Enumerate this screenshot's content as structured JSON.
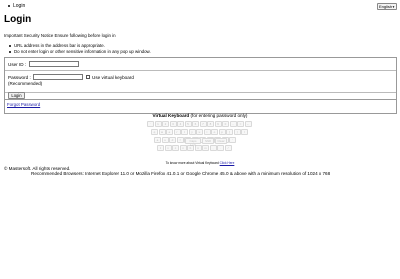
{
  "nav": {
    "login_link": "Login"
  },
  "language": {
    "selected": "English"
  },
  "page": {
    "title": "Login"
  },
  "notice": {
    "heading": "Important Security Notice Ensure following before login in",
    "items": [
      "URL address in the address bar is appropriate.",
      "Do not enter login or other sensitive information in any pop up window."
    ]
  },
  "form": {
    "userid_label": "User ID :",
    "userid_value": "",
    "password_label": "Password :",
    "password_value": "",
    "recommended": "(Recommended)",
    "virtual_keyboard_label": "Use virtual keyboard",
    "login_button": "Login",
    "forgot_link": "Forgot Password"
  },
  "virtual_keyboard": {
    "title_bold": "Virtual Keyboard",
    "title_rest": " (for entering password only)",
    "hint": "To know more about Virtual Keyboard",
    "hint_link": "Click Here",
    "keys": {
      "row1": [
        "`",
        "1",
        "2",
        "3",
        "4",
        "5",
        "6",
        "7",
        "8",
        "9",
        "0",
        "-",
        "=",
        "←"
      ],
      "row2": [
        "q",
        "w",
        "e",
        "r",
        "t",
        "y",
        "u",
        "i",
        "o",
        "p",
        "[",
        "]",
        "\\"
      ],
      "row3": [
        "a",
        "s",
        "d",
        "f",
        "g",
        "h",
        "j",
        "k",
        "l",
        ";",
        "'"
      ],
      "row4": [
        "z",
        "x",
        "c",
        "v",
        "b",
        "n",
        "m",
        ",",
        ".",
        "/"
      ],
      "row5": [
        "Caps Lock",
        "Shift",
        "Clear"
      ]
    }
  },
  "footer": {
    "copyright": "© Mastersoft. All rights reserved.",
    "browsers": "Recommended Browsers: Internet Explorer 11.0 or Mozilla Firefox 41.0.1 or Google Chrome 45.0 & above with a minimum resolution of 1024 x 768"
  }
}
